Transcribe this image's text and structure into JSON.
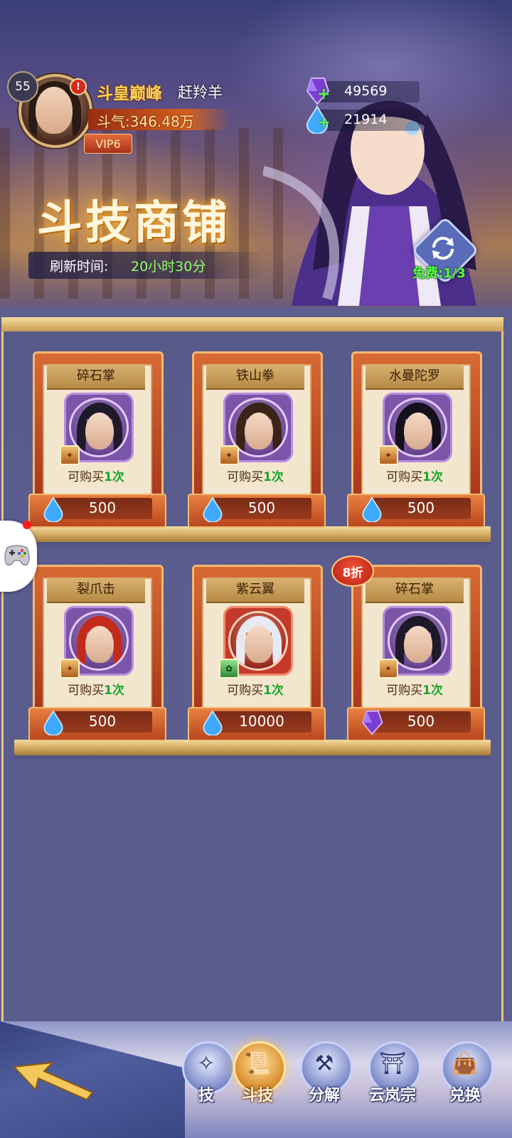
{
  "header": {
    "level": "55",
    "alert_badge": "!",
    "title": "斗皇巅峰",
    "player_name": "赶羚羊",
    "power_label": "斗气:346.48万",
    "vip": "VIP6",
    "currencies": [
      {
        "icon": "purple-crystal-icon",
        "value": "49569"
      },
      {
        "icon": "blue-droplet-icon",
        "value": "21914"
      }
    ],
    "shop_title": "斗技商铺",
    "refresh_label": "刷新时间:",
    "refresh_time": "20小时30分",
    "free_refresh": "免费:1/3"
  },
  "shop": {
    "items": [
      {
        "name": "碎石掌",
        "limit_prefix": "可购买",
        "limit_count": "1次",
        "price": "500",
        "currency_icon": "blue-droplet-icon",
        "frame": "purple"
      },
      {
        "name": "铁山拳",
        "limit_prefix": "可购买",
        "limit_count": "1次",
        "price": "500",
        "currency_icon": "blue-droplet-icon",
        "frame": "purple"
      },
      {
        "name": "水曼陀罗",
        "limit_prefix": "可购买",
        "limit_count": "1次",
        "price": "500",
        "currency_icon": "blue-droplet-icon",
        "frame": "purple"
      },
      {
        "name": "裂爪击",
        "limit_prefix": "可购买",
        "limit_count": "1次",
        "price": "500",
        "currency_icon": "blue-droplet-icon",
        "frame": "purple"
      },
      {
        "name": "紫云翼",
        "limit_prefix": "可购买",
        "limit_count": "1次",
        "price": "10000",
        "currency_icon": "blue-droplet-icon",
        "frame": "red"
      },
      {
        "name": "碎石掌",
        "limit_prefix": "可购买",
        "limit_count": "1次",
        "price": "500",
        "currency_icon": "purple-crystal-icon",
        "frame": "purple",
        "discount": "8折"
      }
    ]
  },
  "bottom_nav": {
    "tabs": [
      {
        "label": "技",
        "icon": "skill-icon"
      },
      {
        "label": "斗技",
        "icon": "scroll-icon",
        "active": true
      },
      {
        "label": "分解",
        "icon": "decompose-icon"
      },
      {
        "label": "云岚宗",
        "icon": "sect-icon"
      },
      {
        "label": "兑换",
        "icon": "exchange-bag-icon"
      }
    ]
  },
  "colors": {
    "accent_gold": "#e9c57a",
    "limit_green": "#1aa52a",
    "free_green": "#57ff42",
    "shop_bg": "#5d5f8e"
  }
}
